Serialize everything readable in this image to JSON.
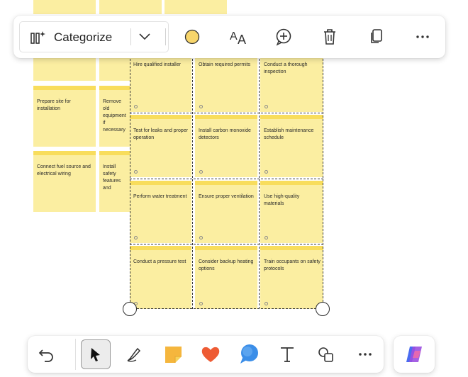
{
  "toolbar": {
    "categorize_label": "Categorize",
    "note_color": "#f7d56b",
    "icons": [
      "categorize-icon",
      "chevron-down-icon",
      "color-circle-icon",
      "text-format-icon",
      "add-reaction-icon",
      "trash-icon",
      "copy-icon",
      "more-icon"
    ]
  },
  "notes": {
    "n1": "Hire qualified installer",
    "n2": "Obtain required permits",
    "n3": "Conduct a thorough inspection",
    "n4": "Test for leaks and proper operation",
    "n5": "Install carbon monoxide detectors",
    "n6": "Establish maintenance schedule",
    "n7": "Perform water treatment",
    "n8": "Ensure proper ventilation",
    "n9": "Use high-quality materials",
    "n10": "Conduct a pressure test",
    "n11": "Consider backup heating options",
    "n12": "Train occupants on safety protocols",
    "b1": "Prepare site for installation",
    "b2": "Remove old equipment if necessary",
    "b3": "Connect fuel source and electrical wiring",
    "b4": "Install safety features and"
  },
  "bottom_toolbar": {
    "icons": [
      "undo-icon",
      "select-icon",
      "pen-icon",
      "sticky-note-icon",
      "heart-icon",
      "comment-icon",
      "text-icon",
      "shapes-icon",
      "more-icon",
      "copilot-icon"
    ]
  }
}
